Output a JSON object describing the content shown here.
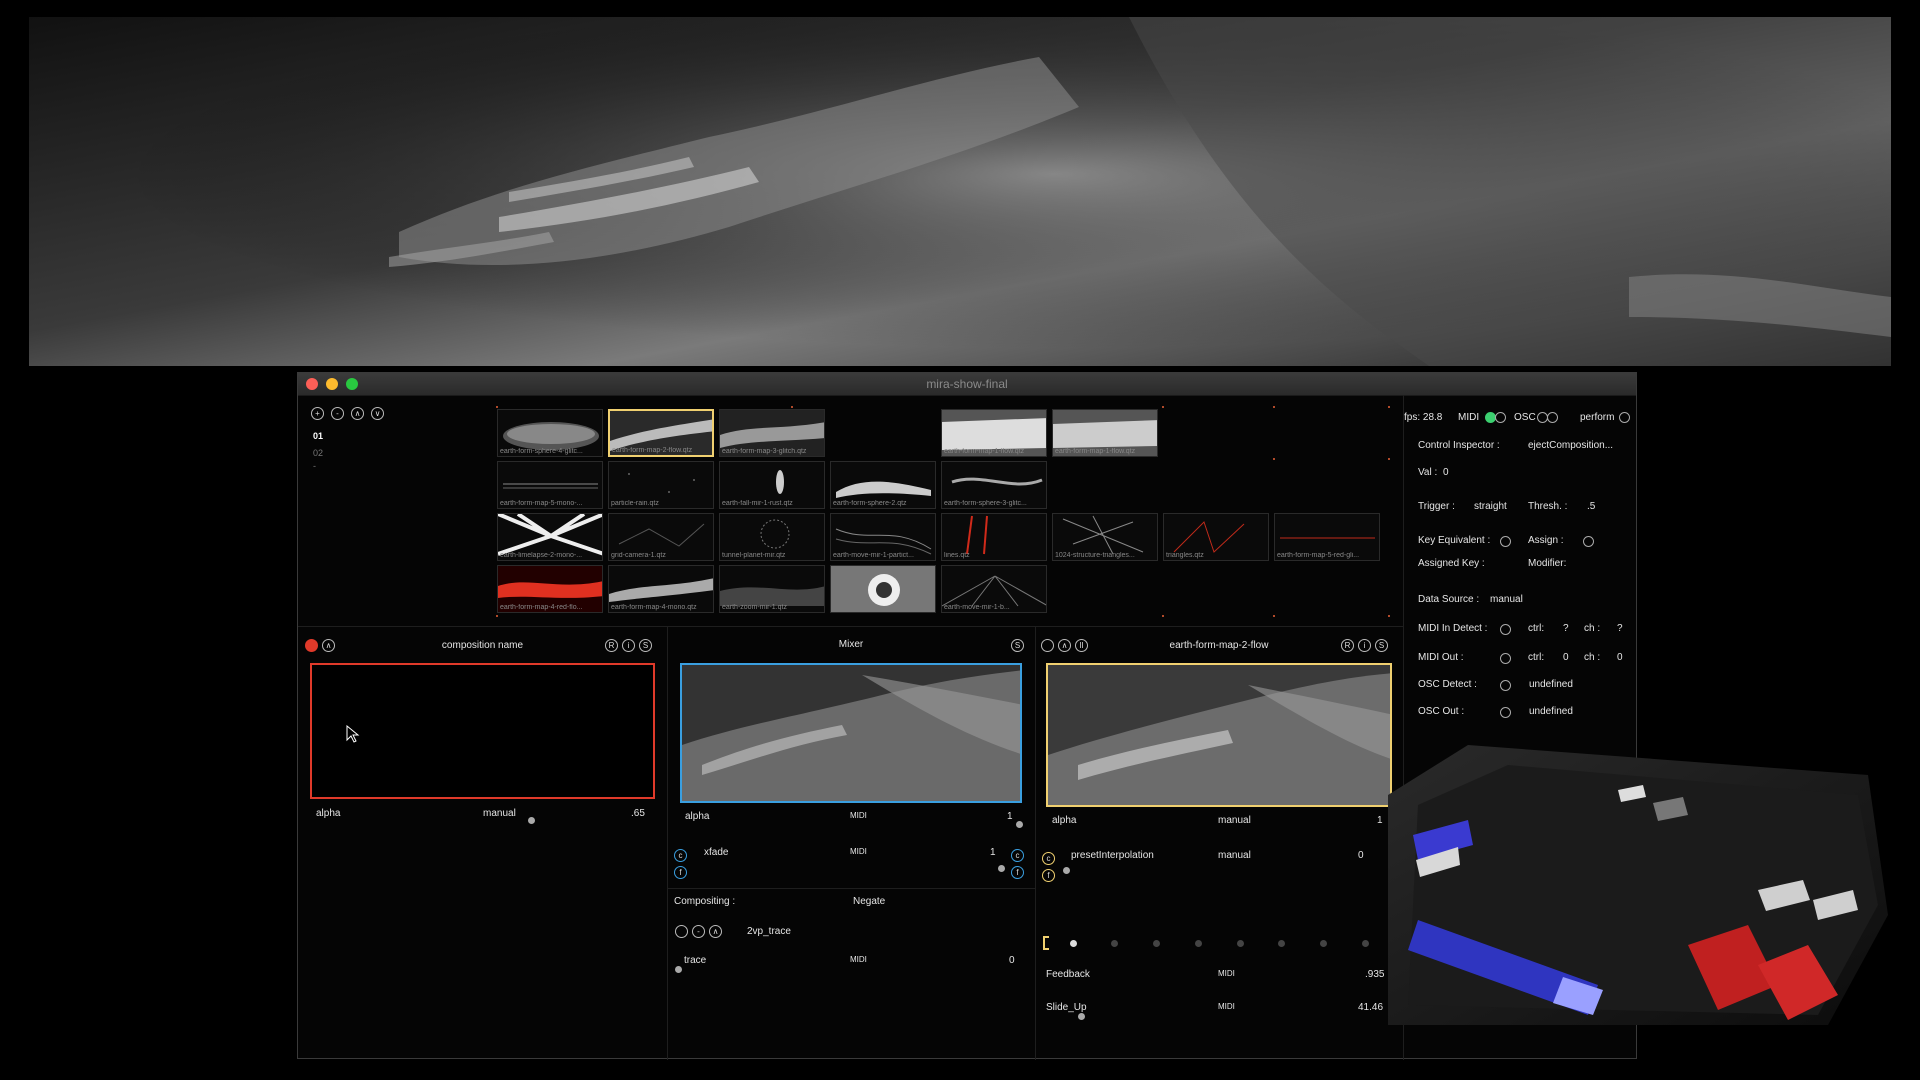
{
  "window": {
    "title": "mira-show-final"
  },
  "toolbar": {
    "add": "+",
    "remove": "-",
    "up": "∧",
    "down": "∨"
  },
  "pages": [
    "01",
    "02",
    "-"
  ],
  "thumbnails": [
    "earth-form-sphere-4-glitc...",
    "earth-form-map-2-flow.qtz",
    "earth-form-map-3-glitch.qtz",
    "earth-form-map-1-flow.qtz",
    "earth-form-map-1-flow.qtz",
    "earth-form-map-5-mono-...",
    "particle-rain.qtz",
    "earth-fall-mir-1-rust.qtz",
    "earth-form-sphere-2.qtz",
    "earth-form-sphere-3-glitc...",
    "earth-limelapse-2-mono-...",
    "grid-camera-1.qtz",
    "tunnel-planet-mir.qtz",
    "earth-move-mir-1-partict...",
    "lines.qtz",
    "1024-structure-triangles...",
    "triangles.qtz",
    "earth-form-map-5-red-gli...",
    "earth-form-map-4-red-flo...",
    "earth-form-map-4-mono.qtz",
    "earth-zoom-mir-1.qtz",
    "",
    "earth-move-mir-1-b..."
  ],
  "left_panel": {
    "title": "composition name",
    "buttons": [
      "R",
      "i",
      "S"
    ],
    "up": "∧",
    "param": "alpha",
    "mode": "manual",
    "value": ".65"
  },
  "mixer": {
    "title": "Mixer",
    "solo": "S",
    "alpha_label": "alpha",
    "alpha_mode": "MIDI",
    "alpha_value": "1",
    "xfade_label": "xfade",
    "xfade_mode": "MIDI",
    "xfade_value": "1",
    "c": "c",
    "f": "f",
    "compositing_label": "Compositing :",
    "compositing_value": "Negate",
    "minus": "-",
    "up": "∧",
    "effect_name": "2vp_trace",
    "trace_label": "trace",
    "trace_mode": "MIDI",
    "trace_value": "0"
  },
  "right_panel": {
    "title": "earth-form-map-2-flow",
    "buttons": [
      "R",
      "i",
      "S"
    ],
    "up": "∧",
    "pause": "II",
    "alpha_label": "alpha",
    "alpha_mode": "manual",
    "alpha_value": "1",
    "preset_label": "presetInterpolation",
    "preset_mode": "manual",
    "preset_value": "0",
    "c": "c",
    "f": "f",
    "feedback_label": "Feedback",
    "feedback_mode": "MIDI",
    "feedback_value": ".935",
    "slide_label": "Slide_Up",
    "slide_mode": "MIDI",
    "slide_value": "41.46"
  },
  "status": {
    "fps": "fps: 28.8",
    "midi": "MIDI",
    "osc": "OSC",
    "perform": "perform"
  },
  "inspector": {
    "control_label": "Control Inspector :",
    "control_value": "ejectComposition...",
    "val_label": "Val :",
    "val_value": "0",
    "trigger_label": "Trigger :",
    "trigger_value": "straight",
    "thresh_label": "Thresh. :",
    "thresh_value": ".5",
    "key_eq_label": "Key Equivalent :",
    "assign_label": "Assign :",
    "assigned_key_label": "Assigned Key :",
    "modifier_label": "Modifier:",
    "data_source_label": "Data Source :",
    "data_source_value": "manual",
    "midi_in_label": "MIDI In Detect :",
    "midi_in_ctrl": "ctrl:",
    "midi_in_ctrl_v": "?",
    "midi_in_ch": "ch :",
    "midi_in_ch_v": "?",
    "midi_out_label": "MIDI Out :",
    "midi_out_ctrl": "ctrl:",
    "midi_out_ctrl_v": "0",
    "midi_out_ch": "ch :",
    "midi_out_ch_v": "0",
    "osc_detect_label": "OSC Detect :",
    "osc_detect_value": "undefined",
    "osc_out_label": "OSC Out :",
    "osc_out_value": "undefined"
  },
  "colors": {
    "accent_red": "#e03a2a",
    "accent_blue": "#3a9fe0",
    "accent_yellow": "#f0d070",
    "green_led": "#3cd070"
  }
}
